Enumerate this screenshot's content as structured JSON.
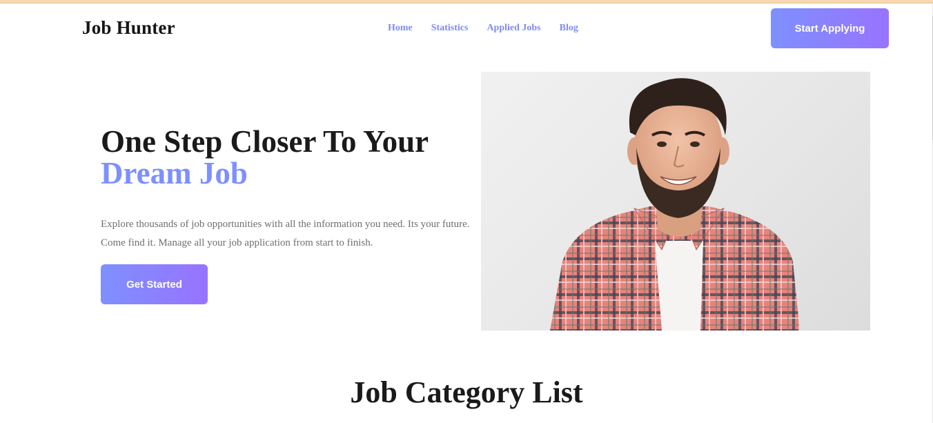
{
  "header": {
    "brand": "Job Hunter",
    "nav": [
      {
        "label": "Home"
      },
      {
        "label": "Statistics"
      },
      {
        "label": "Applied Jobs"
      },
      {
        "label": "Blog"
      }
    ],
    "cta_label": "Start Applying"
  },
  "hero": {
    "title_line1": "One Step Closer To Your",
    "title_accent": "Dream Job",
    "description": "Explore thousands of job opportunities with all the information you need. Its your future. Come find it. Manage all your job application from start to finish.",
    "button_label": "Get Started",
    "image_subject": "smiling-man-plaid-shirt"
  },
  "sections": {
    "category_title": "Job Category List"
  },
  "colors": {
    "accent": "#7e90fe",
    "gradient_start": "#7e90fe",
    "gradient_end": "#9873ff",
    "text_dark": "#1a1a1a",
    "text_muted": "#6f6f6f"
  }
}
